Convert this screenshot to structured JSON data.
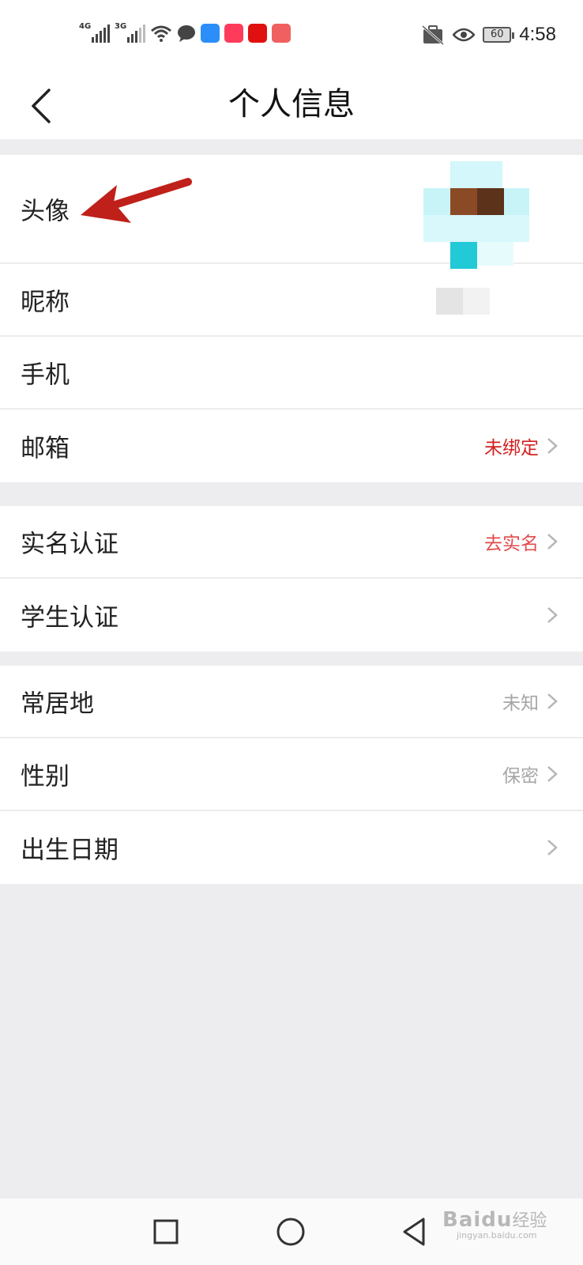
{
  "status_bar": {
    "net1": "4G",
    "net2": "3G",
    "battery": "60",
    "time": "4:58"
  },
  "header": {
    "title": "个人信息"
  },
  "groups": [
    {
      "rows": [
        {
          "label": "头像",
          "value": ""
        },
        {
          "label": "昵称",
          "value": ""
        },
        {
          "label": "手机",
          "value": ""
        },
        {
          "label": "邮箱",
          "value": "未绑定"
        }
      ]
    },
    {
      "rows": [
        {
          "label": "实名认证",
          "value": "去实名"
        },
        {
          "label": "学生认证",
          "value": ""
        }
      ]
    },
    {
      "rows": [
        {
          "label": "常居地",
          "value": "未知"
        },
        {
          "label": "性别",
          "value": "保密"
        },
        {
          "label": "出生日期",
          "value": ""
        }
      ]
    }
  ],
  "colors": {
    "accent_red": "#d32121",
    "muted_grey": "#a5a5a5",
    "background": "#ededf0"
  },
  "watermark": {
    "brand": "Bai",
    "brand2": "du",
    "cn": "经验",
    "url": "jingyan.baidu.com"
  }
}
